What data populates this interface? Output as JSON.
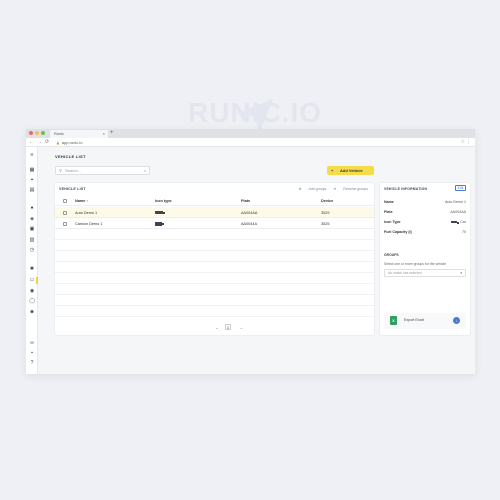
{
  "watermark": {
    "brand": "RUNIC.IO"
  },
  "browser": {
    "tab_title": "Runic",
    "tab_close": "×",
    "new_tab": "+",
    "url": "app.runic.io",
    "back": "←",
    "forward": "→",
    "reload": "⟳"
  },
  "sidebar": {
    "icons": [
      "menu-icon",
      "dashboard-icon",
      "map-pin-icon",
      "inbox-icon",
      "gear-icon",
      "layers-icon",
      "grid-icon",
      "chart-icon",
      "history-icon",
      "settings-icon",
      "vehicle-icon",
      "device-icon",
      "chat-icon",
      "user-icon",
      "link-icon",
      "lock-icon",
      "help-icon"
    ],
    "active": "vehicle-icon",
    "colors": {
      "active_marker": "#f3d23c"
    }
  },
  "page": {
    "title": "VEHICLE LIST"
  },
  "search": {
    "placeholder": "Search..."
  },
  "add_button": {
    "label": "Add Vehicle",
    "color": "#f5dc4b"
  },
  "list": {
    "title": "VEHICLE LIST",
    "actions": {
      "add_groups": "Add groups",
      "remove_groups": "Remove groups"
    },
    "columns": [
      "Name ↑",
      "Icon type",
      "Plate",
      "Device"
    ],
    "rows": [
      {
        "name": "Auto Demo 1",
        "icon_type": "truck",
        "plate": "AA004AA",
        "device": "3529",
        "selected": true
      },
      {
        "name": "Camion Demo 1",
        "icon_type": "bus",
        "plate": "AA0044A",
        "device": "3525",
        "selected": false
      }
    ],
    "pagination": {
      "prev": "←",
      "current": "1",
      "next": "→"
    }
  },
  "info": {
    "title": "VEHICLE INFORMATION",
    "edit_label": "Edit",
    "fields": [
      {
        "key": "Name",
        "value": "Auto Demo 1"
      },
      {
        "key": "Plate",
        "value": "AA004AA"
      },
      {
        "key": "Icon Type",
        "value": "Car"
      },
      {
        "key": "Fuel Capacity (l)",
        "value": "70"
      }
    ],
    "groups": {
      "title": "GROUPS",
      "description": "Select one or more groups for the vehicle",
      "placeholder": "No match has selected"
    },
    "export": {
      "label": "Export Excel",
      "icon_letter": "X"
    }
  }
}
